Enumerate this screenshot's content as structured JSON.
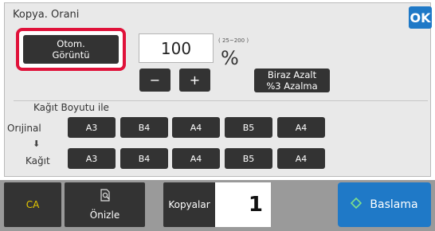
{
  "panel": {
    "title": "Kopya. Orani",
    "ok_label": "OK",
    "auto_image_label": "Otom.\nGörüntü",
    "ratio_value": "100",
    "ratio_range": "( 25~200 )",
    "percent_sign": "%",
    "minus_label": "−",
    "plus_label": "+",
    "reduce_label": "Biraz Azalt\n%3 Azalma"
  },
  "paper_section": {
    "title": "Kağıt Boyutu ile",
    "original_label": "Orıjinal",
    "paper_label": "Kağıt",
    "arrow": "⬇",
    "original_sizes": [
      "A3",
      "B4",
      "A4",
      "B5",
      "A4"
    ],
    "paper_sizes": [
      "A3",
      "B4",
      "A4",
      "B5",
      "A4"
    ]
  },
  "bottom_bar": {
    "ca_label": "CA",
    "preview_label": "Önizle",
    "copies_label": "Kopyalar",
    "copies_value": "1",
    "start_label": "Baslama"
  },
  "colors": {
    "accent_blue": "#1f79c7",
    "highlight_red": "#e0123a",
    "button_dark": "#333333",
    "ca_yellow": "#e5c800"
  }
}
